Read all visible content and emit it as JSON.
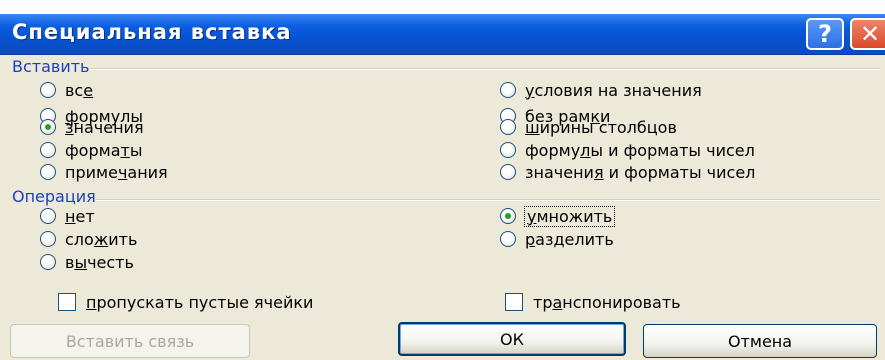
{
  "dialog": {
    "title": "Специальная вставка",
    "help_label": "?",
    "close_label": "✕"
  },
  "paste": {
    "label": "Вставить",
    "selected": "values",
    "options_left": [
      {
        "pre": "вс",
        "u": "е",
        "post": ""
      },
      {
        "pre": "",
        "u": "ф",
        "post": "ормулы"
      },
      {
        "pre": "",
        "u": "з",
        "post": "начения"
      },
      {
        "pre": "форма",
        "u": "т",
        "post": "ы"
      },
      {
        "pre": "приме",
        "u": "ч",
        "post": "ания"
      }
    ],
    "options_right": [
      {
        "pre": "",
        "u": "у",
        "post": "словия на значения"
      },
      {
        "pre": "без рам",
        "u": "к",
        "post": "и"
      },
      {
        "pre": "",
        "u": "ш",
        "post": "ирины столбцов"
      },
      {
        "pre": "форму",
        "u": "л",
        "post": "ы и форматы чисел"
      },
      {
        "pre": "значени",
        "u": "я",
        "post": " и форматы чисел"
      }
    ]
  },
  "operation": {
    "label": "Операция",
    "selected": "multiply",
    "options_left": [
      {
        "pre": "",
        "u": "н",
        "post": "ет"
      },
      {
        "pre": "сло",
        "u": "ж",
        "post": "ить"
      },
      {
        "pre": "в",
        "u": "ы",
        "post": "честь"
      }
    ],
    "options_right": [
      {
        "pre": "",
        "u": "у",
        "post": "множить"
      },
      {
        "pre": "",
        "u": "р",
        "post": "азделить"
      }
    ]
  },
  "checks": {
    "skip_blanks": {
      "pre": "",
      "u": "п",
      "post": "ропускать пустые ячейки"
    },
    "transpose": {
      "pre": "тр",
      "u": "а",
      "post": "нспонировать"
    }
  },
  "buttons": {
    "paste_link": "Вставить связь",
    "ok": "ОК",
    "cancel": "Отмена"
  }
}
